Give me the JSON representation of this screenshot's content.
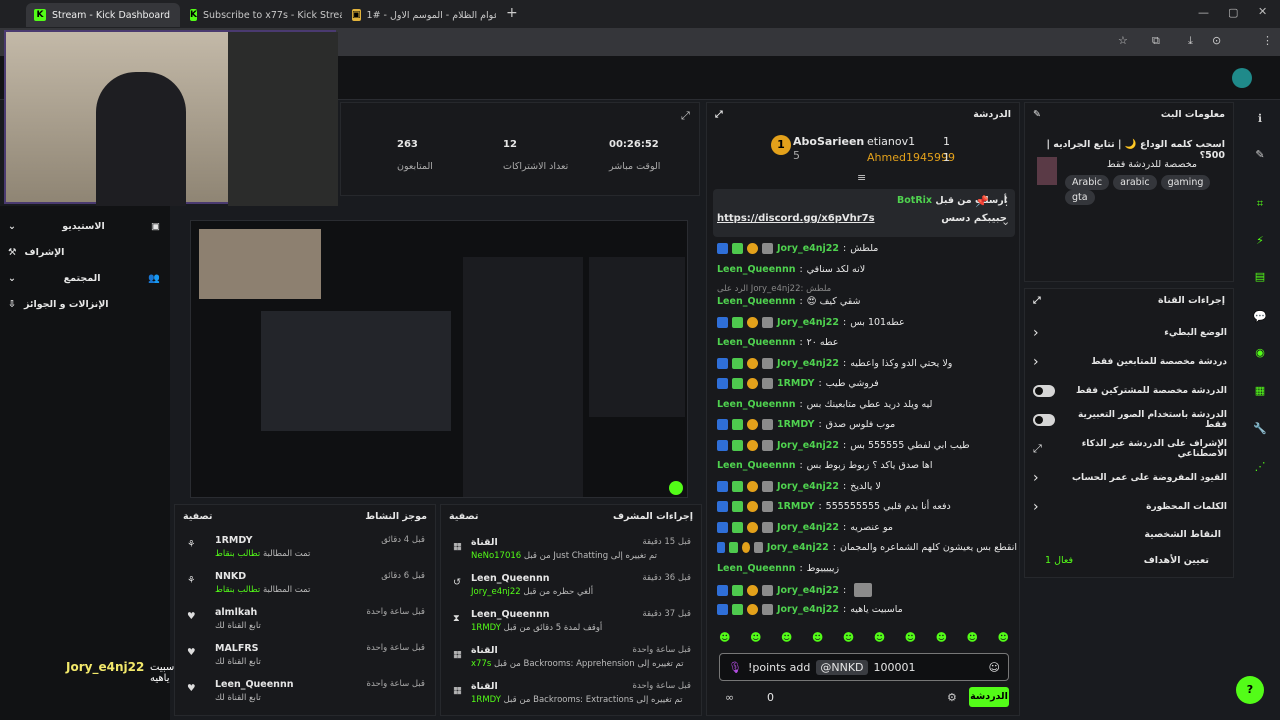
{
  "browser": {
    "tabs": [
      {
        "label": "Stream - Kick Dashboard",
        "active": true
      },
      {
        "label": "Subscribe to x77s - Kick Stream",
        "active": false
      },
      {
        "label": "أعوام الظلام - الموسم الاول - #1",
        "active": false
      }
    ],
    "new_tab": "+"
  },
  "stats": {
    "time_value": "00:26:52",
    "time_label": "الوقت مباشر",
    "subs_value": "12",
    "subs_label": "تعداد الاشتراكات",
    "viewers_value": "263",
    "viewers_label": "المتابعون"
  },
  "sidebar": {
    "items": [
      {
        "label": "الاستيديو"
      },
      {
        "label": "الإشراف"
      },
      {
        "label": "المجتمع"
      },
      {
        "label": "الإنزالات و الجوائز"
      }
    ]
  },
  "activity": {
    "title": "موجز النشاط",
    "filter": "تصفية",
    "items": [
      {
        "user": "1RMDY",
        "time": "قبل 4 دقائق",
        "desc": "تمت المطالبة",
        "tag": "تطالب بنقاط"
      },
      {
        "user": "NNKD",
        "time": "قبل 6 دقائق",
        "desc": "تمت المطالبة",
        "tag": "تطالب بنقاط"
      },
      {
        "user": "almlkah",
        "time": "قبل ساعة واحدة",
        "desc": "تابع القناة لك",
        "tag": ""
      },
      {
        "user": "MALFRS",
        "time": "قبل ساعة واحدة",
        "desc": "تابع القناة لك",
        "tag": ""
      },
      {
        "user": "Leen_Queennn",
        "time": "قبل ساعة واحدة",
        "desc": "تابع القناة لك",
        "tag": ""
      }
    ]
  },
  "modactions": {
    "title": "إجراءات المشرف",
    "filter": "تصفية",
    "items": [
      {
        "user": "القناة",
        "time": "قبل 15 دقيقة",
        "desc": "تم تغييره إلى Just Chatting من قبل",
        "by": "NeNo17016"
      },
      {
        "user": "Leen_Queennn",
        "time": "قبل 36 دقيقة",
        "desc": "ألغي حظره من قبل",
        "by": "Jory_e4nj22"
      },
      {
        "user": "Leen_Queennn",
        "time": "قبل 37 دقيقة",
        "desc": "أوقف لمدة 5 دقائق من قبل",
        "by": "1RMDY"
      },
      {
        "user": "القناة",
        "time": "قبل ساعة واحدة",
        "desc": "تم تغييره إلى Backrooms: Apprehension من قبل",
        "by": "x77s"
      },
      {
        "user": "القناة",
        "time": "قبل ساعة واحدة",
        "desc": "تم تغييره إلى Backrooms: Extractions من قبل",
        "by": "1RMDY"
      }
    ]
  },
  "chat": {
    "title": "الدردشة",
    "leaders": [
      {
        "rank": "1",
        "name": "AboSarieen",
        "count": "5"
      },
      {
        "name": "etianov1",
        "count": "1"
      },
      {
        "name": "Ahmed1945999",
        "count": "1"
      }
    ],
    "pinned": {
      "by_label": "أرسلت من قبل",
      "user": "BotRix",
      "text": "حبيبكم دسس",
      "link": "https://discord.gg/x6pVhr7s"
    },
    "messages": [
      {
        "user": "Jory_e4nj22",
        "text": "ملطش"
      },
      {
        "user": "Leen_Queennn",
        "text": "لانه لكد سنافي"
      },
      {
        "user": "Leen_Queennn",
        "text": "شقي كيف 😍",
        "reply": "الرد على Jory_e4nj22: ملطش"
      },
      {
        "user": "Jory_e4nj22",
        "text": "عطه101 بس"
      },
      {
        "user": "Leen_Queennn",
        "text": "عطه ٢٠"
      },
      {
        "user": "Jory_e4nj22",
        "text": "ولا يحتي الدو وكذا واعطيه"
      },
      {
        "user": "1RMDY",
        "text": "فروشي طيب"
      },
      {
        "user": "Leen_Queennn",
        "text": "ليه ويلد دريد عطي متابعينك بس"
      },
      {
        "user": "1RMDY",
        "text": "موب فلوس صدق"
      },
      {
        "user": "Jory_e4nj22",
        "text": "طيب ابي لفطي 555555 بس"
      },
      {
        "user": "Leen_Queennn",
        "text": "اها صدق ياكد ؟ زبوط زبوط بس"
      },
      {
        "user": "Jory_e4nj22",
        "text": "لا يالديخ"
      },
      {
        "user": "1RMDY",
        "text": "دفعه أنا بدم قلبي 555555555"
      },
      {
        "user": "Jory_e4nj22",
        "text": "مو عنصريه"
      },
      {
        "user": "Jory_e4nj22",
        "text": "انقطع بس يعيشون كلهم الشماعره والمجمان"
      },
      {
        "user": "Leen_Queennn",
        "text": "زيييييوط"
      },
      {
        "user": "Jory_e4nj22",
        "text": ""
      },
      {
        "user": "Jory_e4nj22",
        "text": "ماسبيت ياهيه"
      }
    ],
    "input": {
      "cmd": "!points add",
      "mention": "@NNKD",
      "amount": "100001"
    },
    "send_label": "الدردشة",
    "points": "0"
  },
  "info": {
    "title": "معلومات البث",
    "stream_title": "اسحب كلمه الوداع 🌙 | تتابع الجراديه | 500؟",
    "category": "مخصصة للدردشة فقط",
    "tags": [
      "Arabic",
      "arabic",
      "gaming",
      "gta"
    ]
  },
  "channel": {
    "title": "إجراءات القناة",
    "items": [
      {
        "label": "الوضع البطيء",
        "ctl": "chev"
      },
      {
        "label": "دردشة مخصصة للمتابعين فقط",
        "ctl": "chev"
      },
      {
        "label": "الدردشة مخصصة للمشتركين فقط",
        "ctl": "toggle"
      },
      {
        "label": "الدردشة باستخدام الصور التعبيرية فقط",
        "ctl": "toggle"
      },
      {
        "label": "الإشراف على الدردشة عبر الذكاء الاصطناعي",
        "ctl": "ext"
      },
      {
        "label": "القيود المفروضة على عمر الحساب",
        "ctl": "chev"
      },
      {
        "label": "الكلمات المحظورة",
        "ctl": "chev"
      }
    ],
    "points_section": "النقاط الشخصية",
    "goals": "تعيين الأهداف",
    "goals_active": "1 فعال"
  },
  "overlay": {
    "name": "Jory_e4nj22",
    "msg": "ماسبيت ياهيه"
  },
  "colors": {
    "accent": "#53fc18",
    "bg": "#191b1f"
  }
}
